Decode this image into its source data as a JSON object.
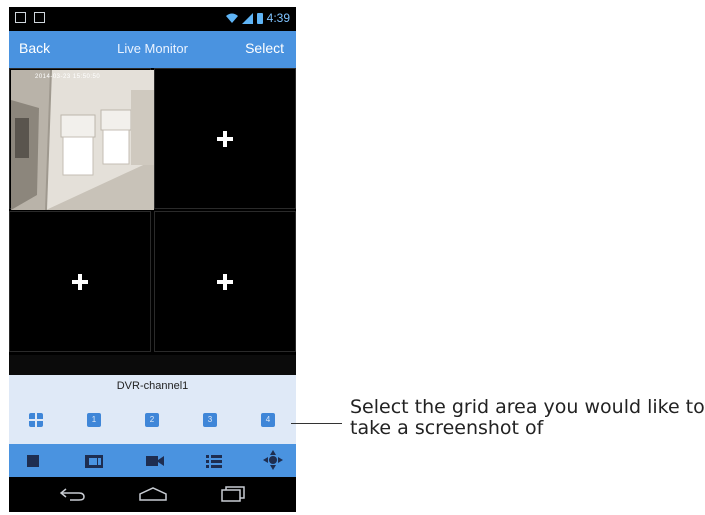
{
  "status_bar": {
    "time": "4:39"
  },
  "header": {
    "back_label": "Back",
    "title": "Live Monitor",
    "select_label": "Select"
  },
  "video": {
    "timestamp": "2014-03-23 15:50:50"
  },
  "channel": {
    "name": "DVR-channel1"
  },
  "grid_buttons": [
    "1",
    "2",
    "3",
    "4"
  ],
  "toolbar_icons": [
    "stop-icon",
    "snapshot-icon",
    "record-icon",
    "list-icon",
    "ptz-icon"
  ],
  "nav_icons": [
    "back-icon",
    "home-icon",
    "recent-apps-icon"
  ],
  "callout": {
    "text": "Select the grid area you would like to take a screenshot of"
  },
  "colors": {
    "accent": "#4a93e0",
    "button_blue": "#3f86d8",
    "panel": "#dfe9f7"
  }
}
